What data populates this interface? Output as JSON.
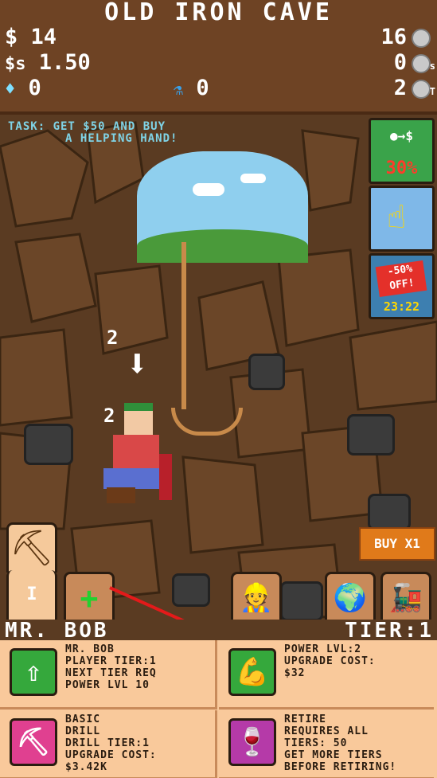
{
  "header": {
    "title": "OLD IRON CAVE",
    "money": "$ 14",
    "money_per_sec_label": "$s",
    "money_per_sec": "1.50",
    "gems": "0",
    "potions": "0",
    "ore_count": "16",
    "ore_per_sec": "0",
    "ore_tier": "2"
  },
  "task": {
    "line1": "TASK: GET $50 AND BUY",
    "line2": "A HELPING HAND!"
  },
  "side_buttons": {
    "boost_label": "30%",
    "boost_icon": "ore-to-cash-icon",
    "tap_icon": "tap-hand-icon",
    "sale_label": "-50% OFF!",
    "sale_timer": "23:22"
  },
  "mining": {
    "damage_top": "2",
    "damage_bottom": "2"
  },
  "buy_button": "BUY X1",
  "tool_tabs": {
    "tier_numeral": "I",
    "add_label": "+"
  },
  "player": {
    "name": "MR. BOB",
    "tier_label": "TIER:1"
  },
  "cards": {
    "player_lines": [
      "MR. BOB",
      "PLAYER TIER:1",
      "NEXT TIER REQ",
      "POWER LVL 10"
    ],
    "power_lines": [
      "POWER LVL:2",
      "UPGRADE COST:",
      "$32"
    ],
    "drill_lines": [
      "BASIC",
      "DRILL",
      "DRILL TIER:1",
      "UPGRADE COST:",
      "$3.42K"
    ],
    "retire_lines": [
      "RETIRE",
      "REQUIRES ALL",
      "TIERS: 50",
      "GET MORE TIERS",
      "BEFORE RETIRING!"
    ]
  },
  "colors": {
    "top_bar": "#6e4324",
    "panel": "#f9c99b",
    "task_text": "#7fd3e6",
    "buy_button": "#e07a1a",
    "sale_red": "#e4302a",
    "boost_green": "#3aa34a"
  }
}
